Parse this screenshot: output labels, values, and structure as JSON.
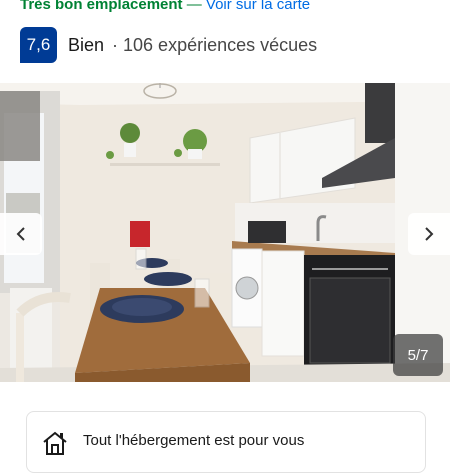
{
  "header": {
    "location_text": "Très bon emplacement",
    "separator": " — ",
    "map_link": "Voir sur la carte"
  },
  "rating": {
    "score": "7,6",
    "word": "Bien",
    "reviews": "· 106 expériences vécues"
  },
  "gallery": {
    "counter": "5/7",
    "prev_icon": "chevron-left-icon",
    "next_icon": "chevron-right-icon"
  },
  "facility": {
    "icon": "house-icon",
    "text": "Tout l'hébergement est pour vous"
  },
  "colors": {
    "location_green": "#008234",
    "link_blue": "#006ce4",
    "score_blue": "#003b95"
  }
}
